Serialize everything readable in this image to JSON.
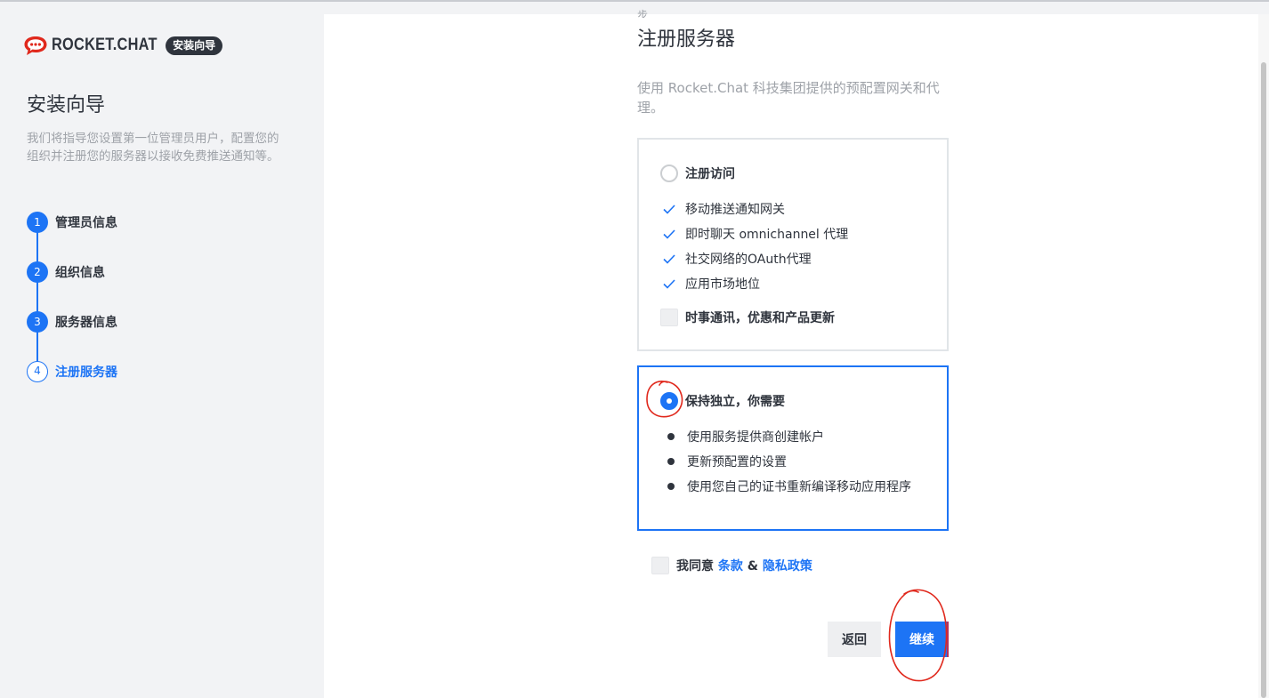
{
  "sidebar": {
    "logo": {
      "brand": "ROCKET.CHAT",
      "badge": "安装向导"
    },
    "title": "安装向导",
    "description": "我们将指导您设置第一位管理员用户，配置您的组织并注册您的服务器以接收免费推送通知等。",
    "steps": [
      {
        "number": "1",
        "label": "管理员信息",
        "state": "done"
      },
      {
        "number": "2",
        "label": "组织信息",
        "state": "done"
      },
      {
        "number": "3",
        "label": "服务器信息",
        "state": "done"
      },
      {
        "number": "4",
        "label": "注册服务器",
        "state": "current"
      }
    ]
  },
  "main": {
    "step_hint": "步",
    "title": "注册服务器",
    "description": "使用 Rocket.Chat 科技集团提供的预配置网关和代理。",
    "option_register": {
      "label": "注册访问",
      "selected": false,
      "features": [
        "移动推送通知网关",
        "即时聊天 omnichannel 代理",
        "社交网络的OAuth代理",
        "应用市场地位"
      ],
      "newsletter_label": "时事通讯，优惠和产品更新"
    },
    "option_standalone": {
      "label": "保持独立，你需要",
      "selected": true,
      "requirements": [
        "使用服务提供商创建帐户",
        "更新预配置的设置",
        "使用您自己的证书重新编译移动应用程序"
      ]
    },
    "agree": {
      "prefix": "我同意",
      "terms": "条款",
      "and": "&",
      "privacy": "隐私政策"
    },
    "buttons": {
      "back": "返回",
      "continue": "继续"
    }
  },
  "colors": {
    "accent": "#1d74f5",
    "text": "#2f343d",
    "muted": "#9ea2a8",
    "annotation": "#e0281c"
  }
}
